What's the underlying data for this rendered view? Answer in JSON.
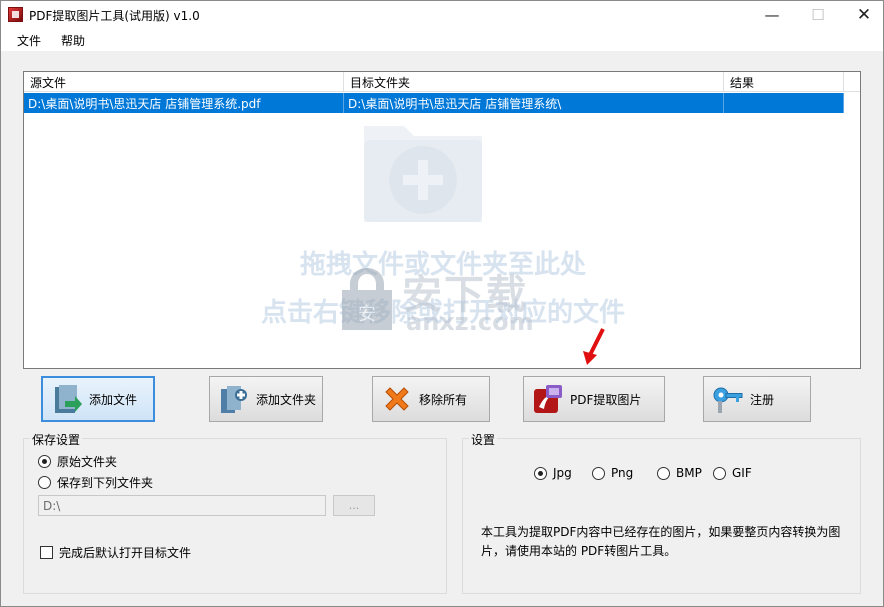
{
  "window": {
    "title": "PDF提取图片工具(试用版) v1.0",
    "minimize": "—",
    "maximize": "☐",
    "close": "✕"
  },
  "menu": {
    "file": "文件",
    "help": "帮助"
  },
  "list": {
    "columns": [
      "源文件",
      "目标文件夹",
      "结果"
    ],
    "rows": [
      {
        "source": "D:\\桌面\\说明书\\思迅天店 店铺管理系统.pdf",
        "target": "D:\\桌面\\说明书\\思迅天店 店铺管理系统\\",
        "result": ""
      }
    ],
    "hint_line1": "拖拽文件或文件夹至此处",
    "hint_line2": "点击右键移除或打开对应的文件",
    "watermark_title": "安下载",
    "watermark_url": "anxz.com",
    "watermark_shield_text": "安"
  },
  "buttons": {
    "add_file": "添加文件",
    "add_folder": "添加文件夹",
    "remove_all": "移除所有",
    "extract": "PDF提取图片",
    "register": "注册"
  },
  "save_settings": {
    "title": "保存设置",
    "option_original": "原始文件夹",
    "option_custom": "保存到下列文件夹",
    "selected": "option_original",
    "path_value": "D:\\",
    "browse_label": "...",
    "open_after": "完成后默认打开目标文件",
    "open_after_checked": false
  },
  "settings": {
    "title": "设置",
    "formats": [
      "Jpg",
      "Png",
      "BMP",
      "GIF"
    ],
    "selected_format": "Jpg",
    "description": "本工具为提取PDF内容中已经存在的图片，如果要整页内容转换为图片，请使用本站的 PDF转图片工具。"
  },
  "colors": {
    "selection": "#0078d7",
    "accent_border": "#3c8ddc",
    "hint_text": "#d8e3f0"
  }
}
